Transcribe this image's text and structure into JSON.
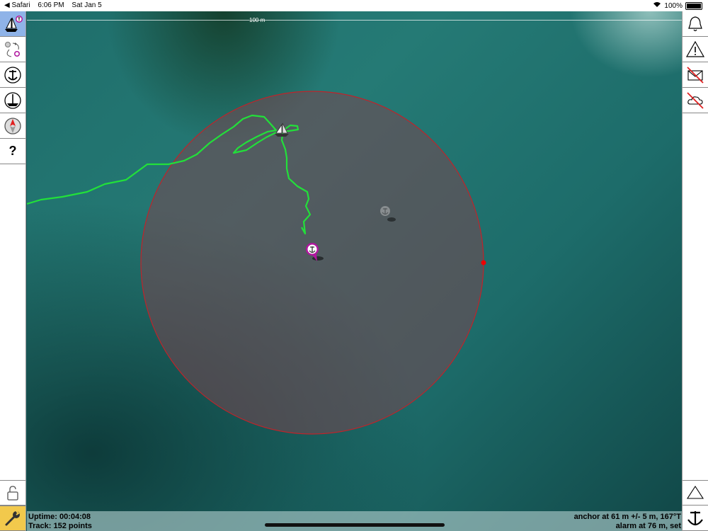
{
  "status_bar": {
    "back_app": "◀ Safari",
    "time": "6:06 PM",
    "date": "Sat Jan 5",
    "battery": "100%"
  },
  "map": {
    "scale_label": "100 m",
    "alarm_circle_color": "#c0232a",
    "track_color": "#22e03a",
    "anchor_marker_color": "#b0169e"
  },
  "left_toolbar": {
    "help_label": "?",
    "items": [
      "boat-mode",
      "route-mode",
      "anchor-mode",
      "depth-anchor",
      "compass",
      "help"
    ],
    "bottom": [
      "unlock",
      "settings"
    ]
  },
  "right_toolbar": {
    "items": [
      "bell",
      "warning",
      "no-email",
      "no-cloud"
    ],
    "bottom": [
      "triangle-up",
      "anchor-drop"
    ]
  },
  "info": {
    "uptime": "Uptime: 00:04:08",
    "track": "Track: 152 points",
    "anchor": "anchor at 61 m +/- 5 m, 167°T",
    "alarm": "alarm at 76 m, set"
  }
}
